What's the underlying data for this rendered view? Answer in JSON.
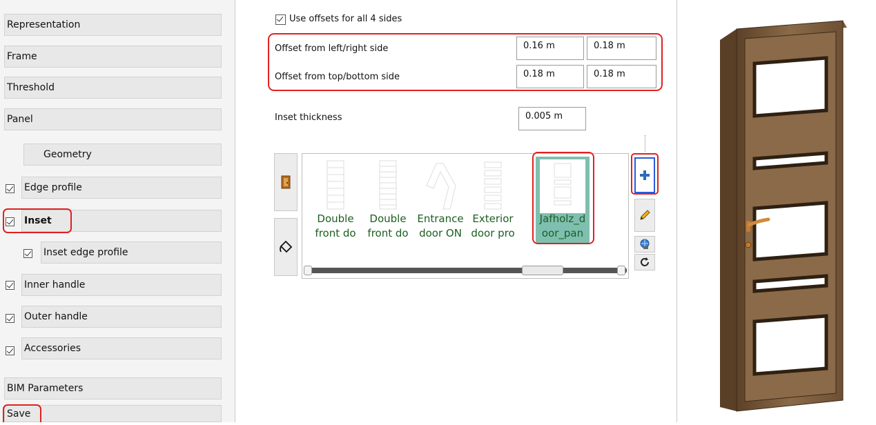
{
  "sidebar": {
    "representation": "Representation",
    "frame": "Frame",
    "threshold": "Threshold",
    "panel": "Panel",
    "geometry": "Geometry",
    "edge_profile": "Edge profile",
    "inset": "Inset",
    "inset_edge_profile": "Inset edge profile",
    "inner_handle": "Inner handle",
    "outer_handle": "Outer handle",
    "accessories": "Accessories",
    "bim_parameters": "BIM Parameters",
    "save": "Save"
  },
  "settings": {
    "use_offsets_label": "Use offsets for all 4 sides",
    "offset_lr_label": "Offset from left/right side",
    "offset_lr_left": "0.16 m",
    "offset_lr_right": "0.18 m",
    "offset_tb_label": "Offset from top/bottom side",
    "offset_tb_top": "0.18 m",
    "offset_tb_bottom": "0.18 m",
    "inset_thickness_label": "Inset thickness",
    "inset_thickness_value": "0.005 m"
  },
  "gallery": {
    "items": [
      {
        "line1": "Double",
        "line2": "front do",
        "icon": "double-front-door-thumb"
      },
      {
        "line1": "Double",
        "line2": "front do",
        "icon": "double-front-door-thumb"
      },
      {
        "line1": "Entrance",
        "line2": "door ON",
        "icon": "entrance-door-thumb"
      },
      {
        "line1": "Exterior",
        "line2": "door pro",
        "icon": "exterior-door-thumb"
      },
      {
        "line1": "Jafholz_d",
        "line2": "oor_pan",
        "icon": "jafholz-door-panel-thumb",
        "selected": true
      }
    ]
  },
  "colors": {
    "highlight": "#e02020",
    "selected_bg": "#7fbfb0",
    "item_text": "#1b5e20",
    "door_wood": "#7a5a3a"
  }
}
